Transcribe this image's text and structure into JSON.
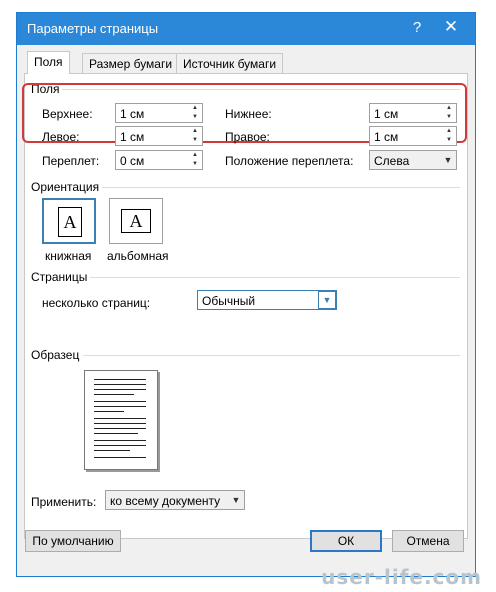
{
  "window": {
    "title": "Параметры страницы",
    "help_label": "?",
    "close_label": "✕"
  },
  "tabs": [
    {
      "label": "Поля",
      "active": true
    },
    {
      "label": "Размер бумаги",
      "active": false
    },
    {
      "label": "Источник бумаги",
      "active": false
    }
  ],
  "margins": {
    "group_label": "Поля",
    "top_label": "Верхнее:",
    "top_value": "1 см",
    "bottom_label": "Нижнее:",
    "bottom_value": "1 см",
    "left_label": "Левое:",
    "left_value": "1 см",
    "right_label": "Правое:",
    "right_value": "1 см",
    "gutter_label": "Переплет:",
    "gutter_value": "0 см",
    "gutter_pos_label": "Положение переплета:",
    "gutter_pos_value": "Слева"
  },
  "orientation": {
    "group_label": "Ориентация",
    "portrait_label": "книжная",
    "landscape_label": "альбомная",
    "icon_letter": "A"
  },
  "pages": {
    "group_label": "Страницы",
    "multiple_label": "несколько страниц:",
    "multiple_value": "Обычный"
  },
  "preview": {
    "group_label": "Образец"
  },
  "apply": {
    "label": "Применить:",
    "value": "ко всему документу"
  },
  "buttons": {
    "default_label": "По умолчанию",
    "ok_label": "ОК",
    "cancel_label": "Отмена"
  },
  "watermark": "user-life.com",
  "colors": {
    "titlebar": "#2b88d8",
    "highlight": "#d03a3a",
    "accent": "#3c7fb1"
  }
}
